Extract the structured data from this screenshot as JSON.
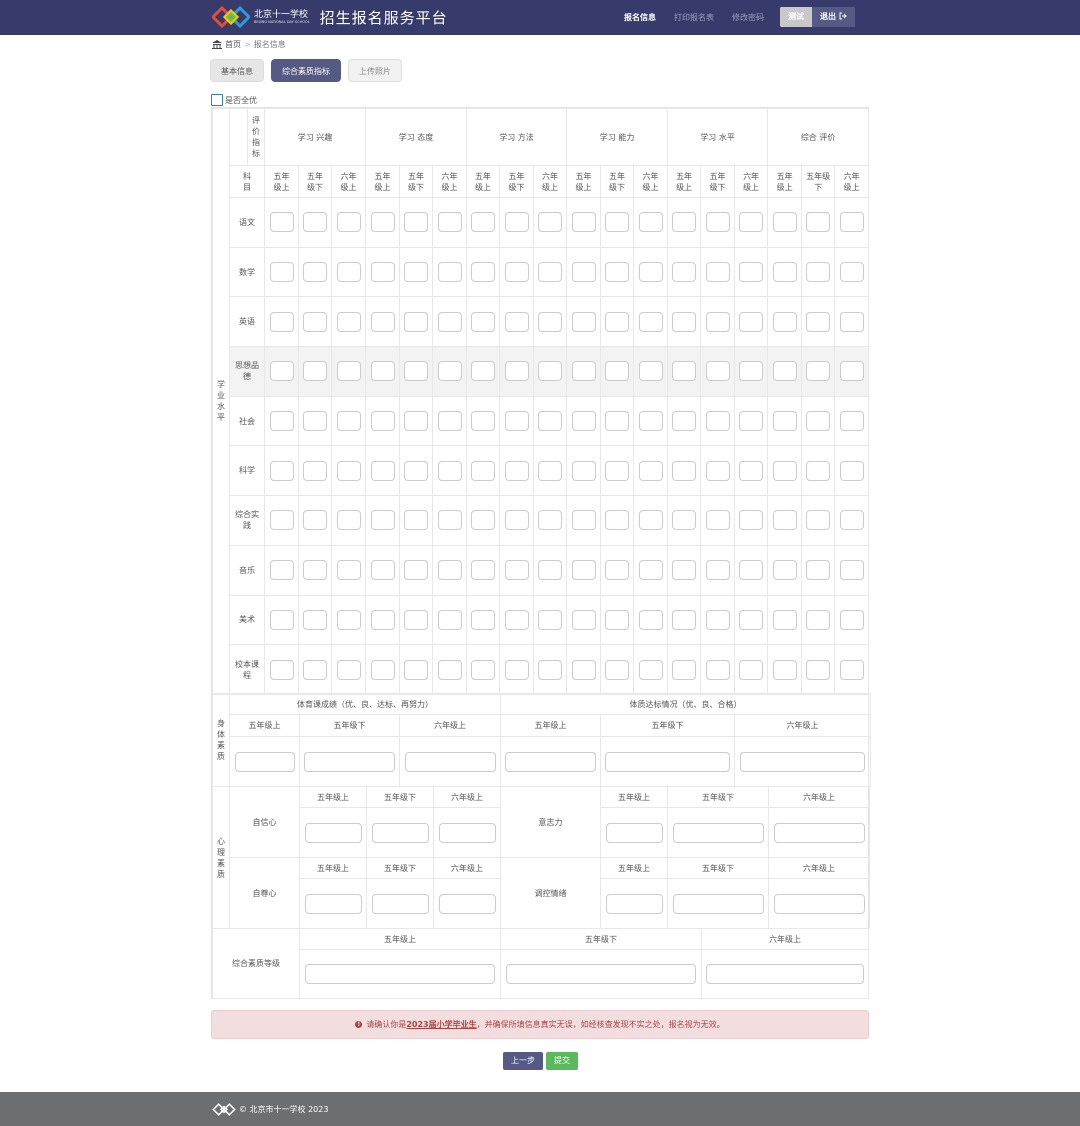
{
  "nav": {
    "logo_cn": "北京十一学校",
    "logo_en": "BEIJING NATIONAL DAY SCHOOL",
    "title": "招生报名服务平台",
    "menu": [
      {
        "label": "报名信息",
        "active": true
      },
      {
        "label": "打印报名表",
        "active": false
      },
      {
        "label": "修改密码",
        "active": false
      }
    ],
    "user": "测试",
    "logout": "退出"
  },
  "breadcrumb": {
    "home": "首页",
    "sep": ">",
    "current": "报名信息"
  },
  "tabs": [
    {
      "label": "基本信息",
      "state": "normal"
    },
    {
      "label": "综合素质指标",
      "state": "active"
    },
    {
      "label": "上传照片",
      "state": "light"
    }
  ],
  "all_excellent": {
    "label": "是否全优",
    "checked": false
  },
  "academic": {
    "section": "学业水平",
    "corner_top": "评价指标",
    "corner_bottom": "科目",
    "indicators": [
      "学习 兴趣",
      "学习 态度",
      "学习 方法",
      "学习 能力",
      "学习 水平",
      "综合 评价"
    ],
    "terms": [
      "五年级上",
      "五年级下",
      "六年级上",
      "五年级上",
      "五年级下",
      "六年级上",
      "五年级上",
      "五年级下",
      "六年级上",
      "五年级上",
      "五年级下",
      "六年级上",
      "五年级上",
      "五年级下",
      "六年级上",
      "五年级上",
      "五年级下",
      "六年级上"
    ],
    "subjects": [
      {
        "name": "语文",
        "highlight": false
      },
      {
        "name": "数学",
        "highlight": false
      },
      {
        "name": "英语",
        "highlight": false
      },
      {
        "name": "思想品德",
        "highlight": true
      },
      {
        "name": "社会",
        "highlight": false
      },
      {
        "name": "科学",
        "highlight": false
      },
      {
        "name": "综合实践",
        "highlight": false
      },
      {
        "name": "音乐",
        "highlight": false
      },
      {
        "name": "美术",
        "highlight": false
      },
      {
        "name": "校本课程",
        "highlight": false
      }
    ]
  },
  "physical": {
    "section": "身体素质",
    "group1": "体育课成绩（优、良、达标、再努力）",
    "group2": "体质达标情况（优、良、合格）",
    "terms": [
      "五年级上",
      "五年级下",
      "六年级上",
      "五年级上",
      "五年级下",
      "六年级上"
    ]
  },
  "psych": {
    "section": "心理素质",
    "items": [
      "自信心",
      "意志力",
      "自尊心",
      "调控情绪"
    ],
    "terms": [
      "五年级上",
      "五年级下",
      "六年级上"
    ]
  },
  "overall": {
    "label": "综合素质等级",
    "terms": [
      "五年级上",
      "五年级下",
      "六年级上"
    ]
  },
  "alert": {
    "pre": "请确认你是",
    "highlight": "2023届小学毕业生",
    "post": "，并确保所填信息真实无误，如经核查发现不实之处，报名视为无效。"
  },
  "buttons": {
    "prev": "上一步",
    "submit": "提交"
  },
  "footer": {
    "text": "© 北京市十一学校 2023"
  },
  "colors": {
    "nav": "#373b6b",
    "accent": "#555a84",
    "success": "#5cb85c",
    "alert_bg": "#f2dede",
    "alert_text": "#a94442",
    "footer": "#6b6f72"
  }
}
